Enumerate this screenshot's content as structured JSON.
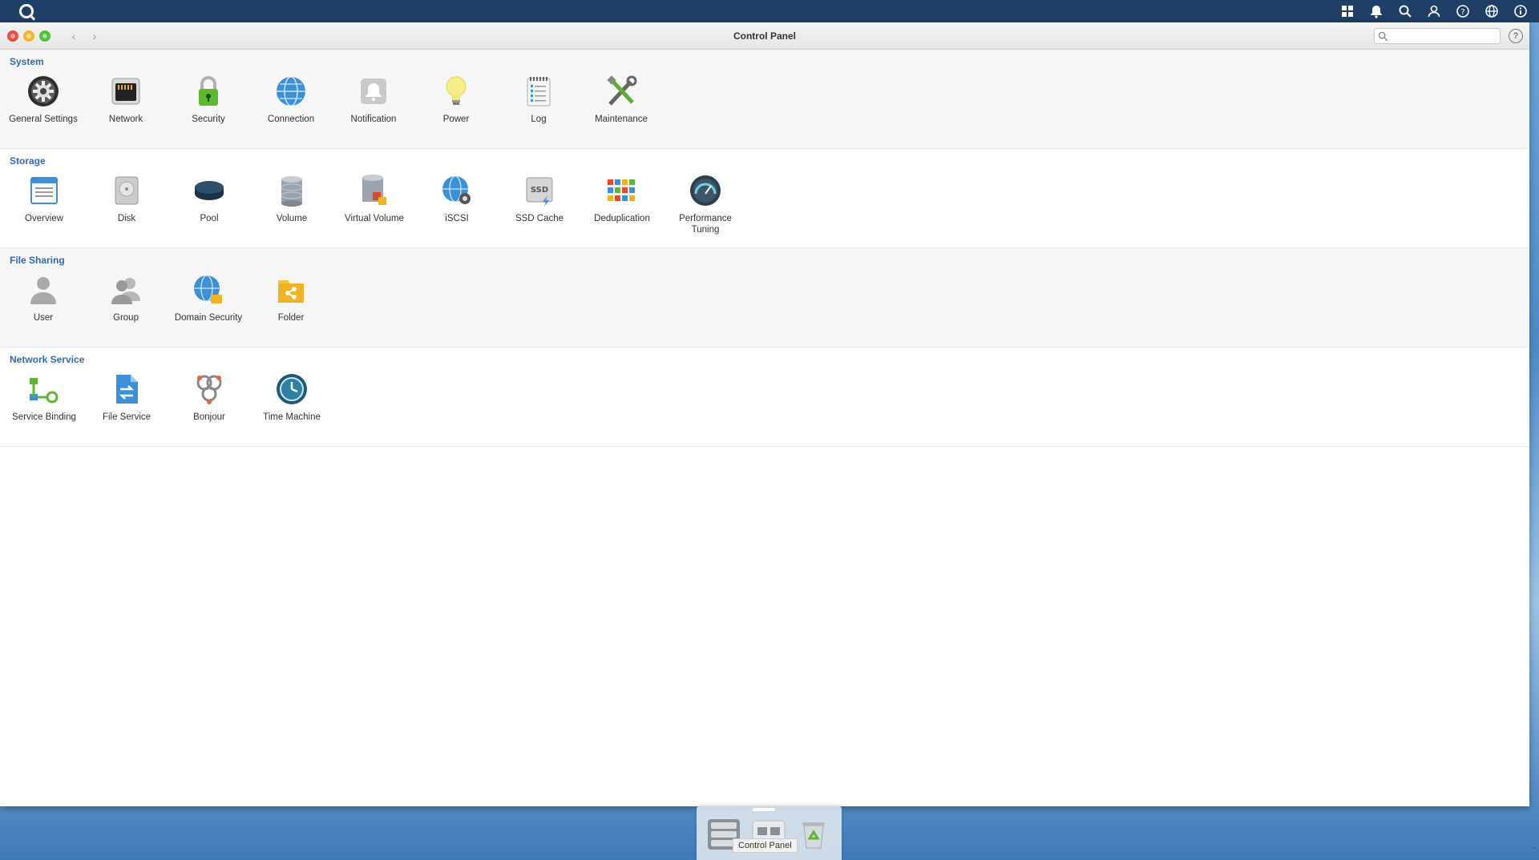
{
  "window": {
    "title": "Control Panel",
    "search_placeholder": "",
    "help_label": "?",
    "back_label": "‹",
    "forward_label": "›"
  },
  "sections": [
    {
      "title": "System",
      "items": [
        {
          "label": "General Settings",
          "icon": "gear-icon"
        },
        {
          "label": "Network",
          "icon": "network-icon"
        },
        {
          "label": "Security",
          "icon": "lock-icon"
        },
        {
          "label": "Connection",
          "icon": "globe-icon"
        },
        {
          "label": "Notification",
          "icon": "bell-icon"
        },
        {
          "label": "Power",
          "icon": "lightbulb-icon"
        },
        {
          "label": "Log",
          "icon": "log-icon"
        },
        {
          "label": "Maintenance",
          "icon": "tools-icon"
        }
      ]
    },
    {
      "title": "Storage",
      "items": [
        {
          "label": "Overview",
          "icon": "overview-icon"
        },
        {
          "label": "Disk",
          "icon": "disk-icon"
        },
        {
          "label": "Pool",
          "icon": "pool-icon"
        },
        {
          "label": "Volume",
          "icon": "volume-icon"
        },
        {
          "label": "Virtual Volume",
          "icon": "virtual-volume-icon"
        },
        {
          "label": "iSCSI",
          "icon": "iscsi-icon"
        },
        {
          "label": "SSD Cache",
          "icon": "ssd-icon"
        },
        {
          "label": "Deduplication",
          "icon": "deduplication-icon"
        },
        {
          "label": "Performance Tuning",
          "icon": "gauge-icon"
        }
      ]
    },
    {
      "title": "File Sharing",
      "items": [
        {
          "label": "User",
          "icon": "user-icon"
        },
        {
          "label": "Group",
          "icon": "group-icon"
        },
        {
          "label": "Domain Security",
          "icon": "domain-icon"
        },
        {
          "label": "Folder",
          "icon": "folder-icon"
        }
      ]
    },
    {
      "title": "Network Service",
      "items": [
        {
          "label": "Service Binding",
          "icon": "service-binding-icon"
        },
        {
          "label": "File Service",
          "icon": "file-service-icon"
        },
        {
          "label": "Bonjour",
          "icon": "bonjour-icon"
        },
        {
          "label": "Time Machine",
          "icon": "clock-icon"
        }
      ]
    }
  ],
  "dock": {
    "tooltip": "Control Panel",
    "items": [
      "storage-manager-icon",
      "control-panel-icon",
      "recycle-bin-icon"
    ]
  },
  "colors": {
    "topbar": "#1f3f66",
    "section_title": "#2f6ab8"
  }
}
